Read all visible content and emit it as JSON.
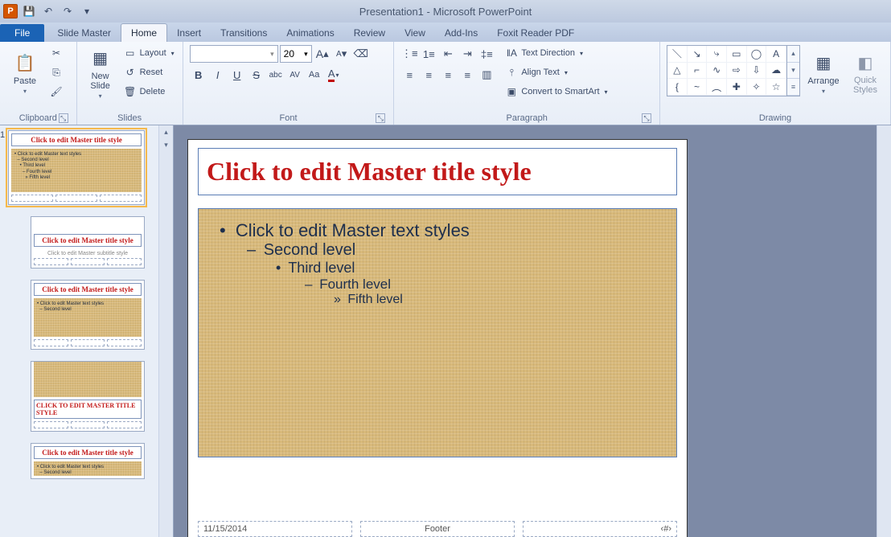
{
  "app": {
    "title": "Presentation1 - Microsoft PowerPoint"
  },
  "qat": {
    "save": "💾",
    "undo": "↶",
    "redo": "↷",
    "more": "▾"
  },
  "tabs": {
    "file": "File",
    "items": [
      "Slide Master",
      "Home",
      "Insert",
      "Transitions",
      "Animations",
      "Review",
      "View",
      "Add-Ins",
      "Foxit Reader PDF"
    ],
    "activeIndex": 1
  },
  "ribbon": {
    "clipboard": {
      "label": "Clipboard",
      "paste": "Paste",
      "cut": "✂",
      "copy": "⎘",
      "fmt": "🖌"
    },
    "slides": {
      "label": "Slides",
      "new": "New\nSlide",
      "layout": "Layout",
      "reset": "Reset",
      "delete": "Delete"
    },
    "font": {
      "label": "Font",
      "name": "",
      "size": "20",
      "bold": "B",
      "italic": "I",
      "underline": "U",
      "strike": "S",
      "shadow": "abc",
      "spacing": "AV",
      "case": "Aa",
      "grow": "A",
      "shrink": "A",
      "clear": "⌫",
      "color": "A"
    },
    "paragraph": {
      "label": "Paragraph",
      "bullets": "≣",
      "numbers": "≣",
      "indentL": "⇤",
      "indentR": "⇥",
      "lineSp": "≡",
      "alignL": "≡",
      "alignC": "≡",
      "alignR": "≡",
      "justify": "≡",
      "cols": "▥",
      "textDir": "Text Direction",
      "alignText": "Align Text",
      "smartArt": "Convert to SmartArt"
    },
    "drawing": {
      "label": "Drawing",
      "arrange": "Arrange",
      "quick": "Quick\nStyles"
    }
  },
  "master": {
    "title": "Click to edit Master title style",
    "l1": "Click to edit Master text styles",
    "l2": "Second level",
    "l3": "Third level",
    "l4": "Fourth level",
    "l5": "Fifth level",
    "date": "11/15/2014",
    "footer": "Footer",
    "num": "‹#›"
  },
  "thumbs": {
    "t1_title": "Click to edit Master title style",
    "t1_body": "• Click to edit Master text styles\n  – Second level\n    • Third level\n      – Fourth level\n        » Fifth level",
    "t2_title": "Click to edit Master title style",
    "t2_sub": "Click to edit Master subtitle style",
    "t3_title": "Click to edit Master title style",
    "t3_body": "• Click to edit Master text styles\n  – Second level",
    "t4_title": "CLICK TO EDIT MASTER TITLE STYLE",
    "t5_title": "Click to edit Master title style"
  }
}
